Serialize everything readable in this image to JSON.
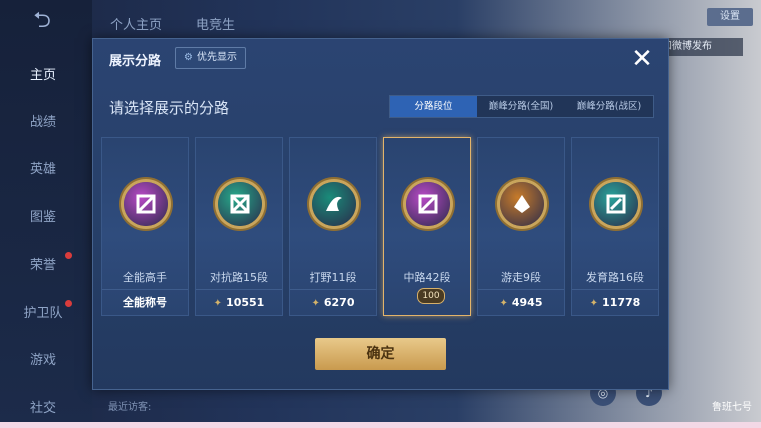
{
  "background": {
    "top_tabs": [
      "个人主页",
      "电竞生"
    ],
    "sidebar": [
      "主页",
      "战绩",
      "英雄",
      "图鉴",
      "荣誉",
      "护卫队",
      "游戏",
      "社交"
    ],
    "top_right_button": "设置",
    "top_right_label": "查看和微博发布",
    "recent_visitors": "最近访客:",
    "hero_label": "鲁班七号"
  },
  "dialog": {
    "title": "展示分路",
    "priority_button": "优先显示",
    "close_label": "✕",
    "subtitle": "请选择展示的分路",
    "segments": [
      "分路段位",
      "巅峰分路(全国)",
      "巅峰分路(战区)"
    ],
    "active_segment": 0,
    "cards": [
      {
        "name": "全能高手",
        "footer": "全能称号",
        "has_score": false,
        "color": "#b84ac6",
        "selected": false
      },
      {
        "name": "对抗路15段",
        "footer": "10551",
        "has_score": true,
        "color": "#27a98a",
        "selected": false
      },
      {
        "name": "打野11段",
        "footer": "6270",
        "has_score": true,
        "color": "#1a8c7a",
        "selected": false
      },
      {
        "name": "中路42段",
        "footer": "",
        "has_score": false,
        "color": "#b84ac6",
        "selected": true,
        "badge": "100"
      },
      {
        "name": "游走9段",
        "footer": "4945",
        "has_score": true,
        "color": "#c77b2a",
        "selected": false
      },
      {
        "name": "发育路16段",
        "footer": "11778",
        "has_score": true,
        "color": "#2aa39a",
        "selected": false
      }
    ],
    "confirm_button": "确定"
  }
}
